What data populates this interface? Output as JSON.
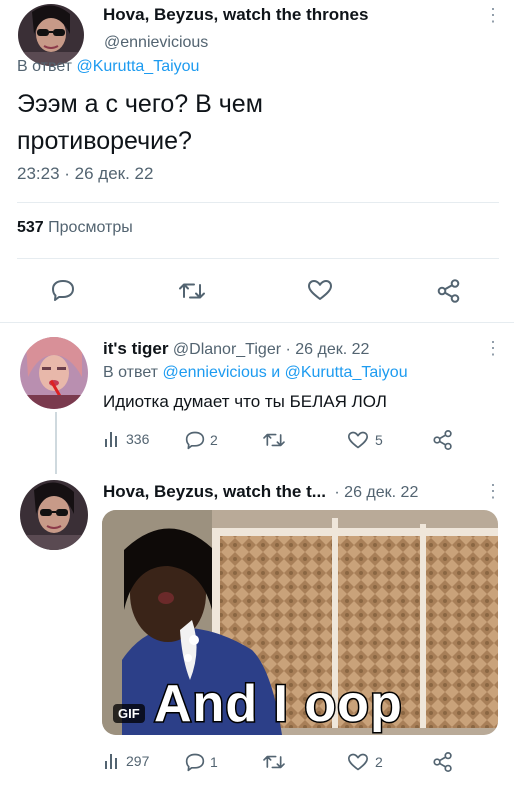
{
  "main_tweet": {
    "display_name": "Hova, Beyzus, watch the thrones",
    "handle": "@ennievicious",
    "reply_prefix": "В ответ",
    "reply_to": "@Kurutta_Taiyou",
    "text_line1": "Эээм а с чего? В чем",
    "text_line2": "противоречие?",
    "timestamp": "23:23 · 26 дек. 22",
    "views_count": "537",
    "views_label": "Просмотры"
  },
  "reply1": {
    "display_name": "it's tiger",
    "handle_date": "@Dlanor_Tiger · 26 дек. 22",
    "reply_prefix": "В ответ",
    "reply_to_1": "@ennievicious",
    "reply_joiner": "и",
    "reply_to_2": "@Kurutta_Taiyou",
    "text": "Идиотка думает что ты БЕЛАЯ ЛОЛ",
    "views": "336",
    "replies": "2",
    "likes": "5"
  },
  "reply2": {
    "display_name": "Hova, Beyzus, watch the t...",
    "date": "· 26 дек. 22",
    "gif_badge": "GIF",
    "gif_caption": "And I oop",
    "views": "297",
    "replies": "1",
    "likes": "2"
  },
  "colors": {
    "accent": "#1d9bf0",
    "muted": "#536471",
    "icon": "#536471",
    "divider": "#e6ecf0"
  },
  "icons": [
    "more-icon",
    "reply-icon",
    "retweet-icon",
    "like-icon",
    "share-icon",
    "views-icon"
  ]
}
